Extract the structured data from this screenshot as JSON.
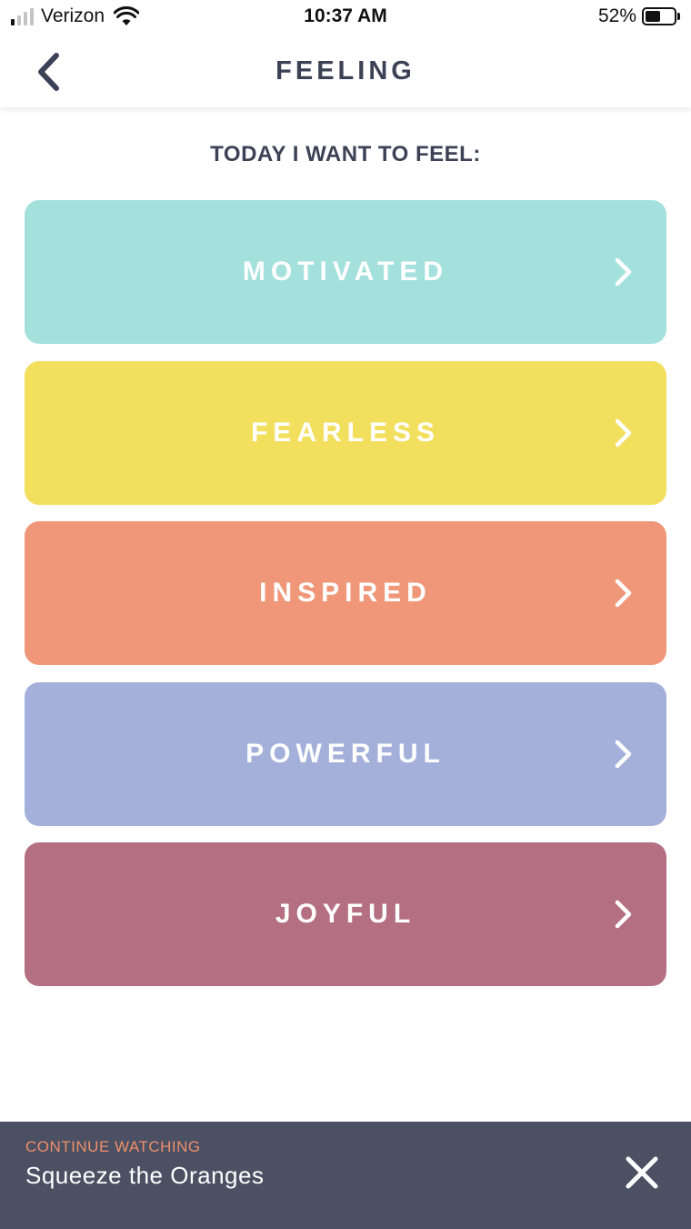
{
  "status_bar": {
    "carrier": "Verizon",
    "time": "10:37 AM",
    "battery_percent": "52%",
    "signal_bars_on": 1,
    "signal_bars_total": 4,
    "battery_level": 0.52
  },
  "nav": {
    "title": "FEELING",
    "back_icon": "chevron-left-icon"
  },
  "prompt": "TODAY I WANT TO FEEL:",
  "feelings": [
    {
      "label": "MOTIVATED",
      "color": "#a5e1dc"
    },
    {
      "label": "FEARLESS",
      "color": "#f3df5e"
    },
    {
      "label": "INSPIRED",
      "color": "#f09779"
    },
    {
      "label": "POWERFUL",
      "color": "#a4b0da"
    },
    {
      "label": "JOYFUL",
      "color": "#b47082"
    }
  ],
  "continue_watching": {
    "label": "CONTINUE WATCHING",
    "title": "Squeeze the Oranges",
    "close_icon": "close-icon"
  },
  "colors": {
    "text_dark": "#3c4256",
    "bar_bg": "#4b5063",
    "accent": "#ee8f6a"
  }
}
